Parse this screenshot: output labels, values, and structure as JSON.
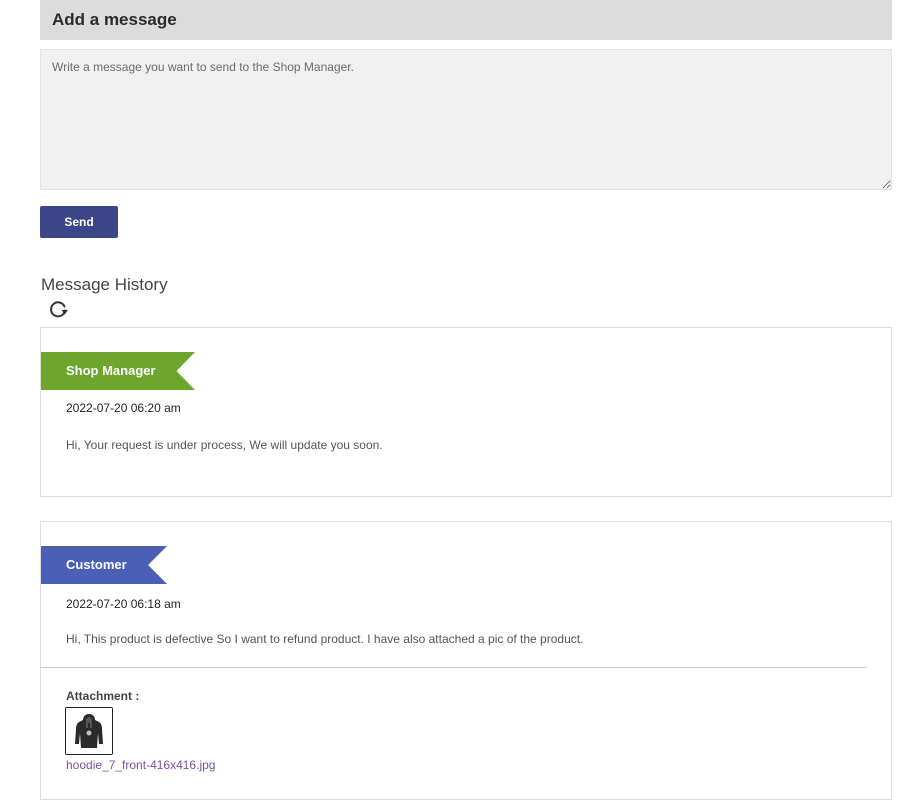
{
  "compose": {
    "header": "Add a message",
    "placeholder": "Write a message you want to send to the Shop Manager.",
    "value": "",
    "send_label": "Send",
    "accent_color": "#3a4687"
  },
  "history": {
    "title": "Message History",
    "refresh_icon": "refresh-icon",
    "messages": [
      {
        "sender": "Shop Manager",
        "sender_color": "#6ea52d",
        "time": "2022-07-20 06:20 am",
        "text": "Hi, Your request is under process, We will update you soon."
      },
      {
        "sender": "Customer",
        "sender_color": "#4b5fb7",
        "time": "2022-07-20 06:18 am",
        "text": "Hi, This product is defective So I want to refund product. I have also attached a pic of the product.",
        "attachment": {
          "label": "Attachment :",
          "thumbnail_icon": "hoodie-image",
          "filename": "hoodie_7_front-416x416.jpg"
        }
      }
    ]
  }
}
